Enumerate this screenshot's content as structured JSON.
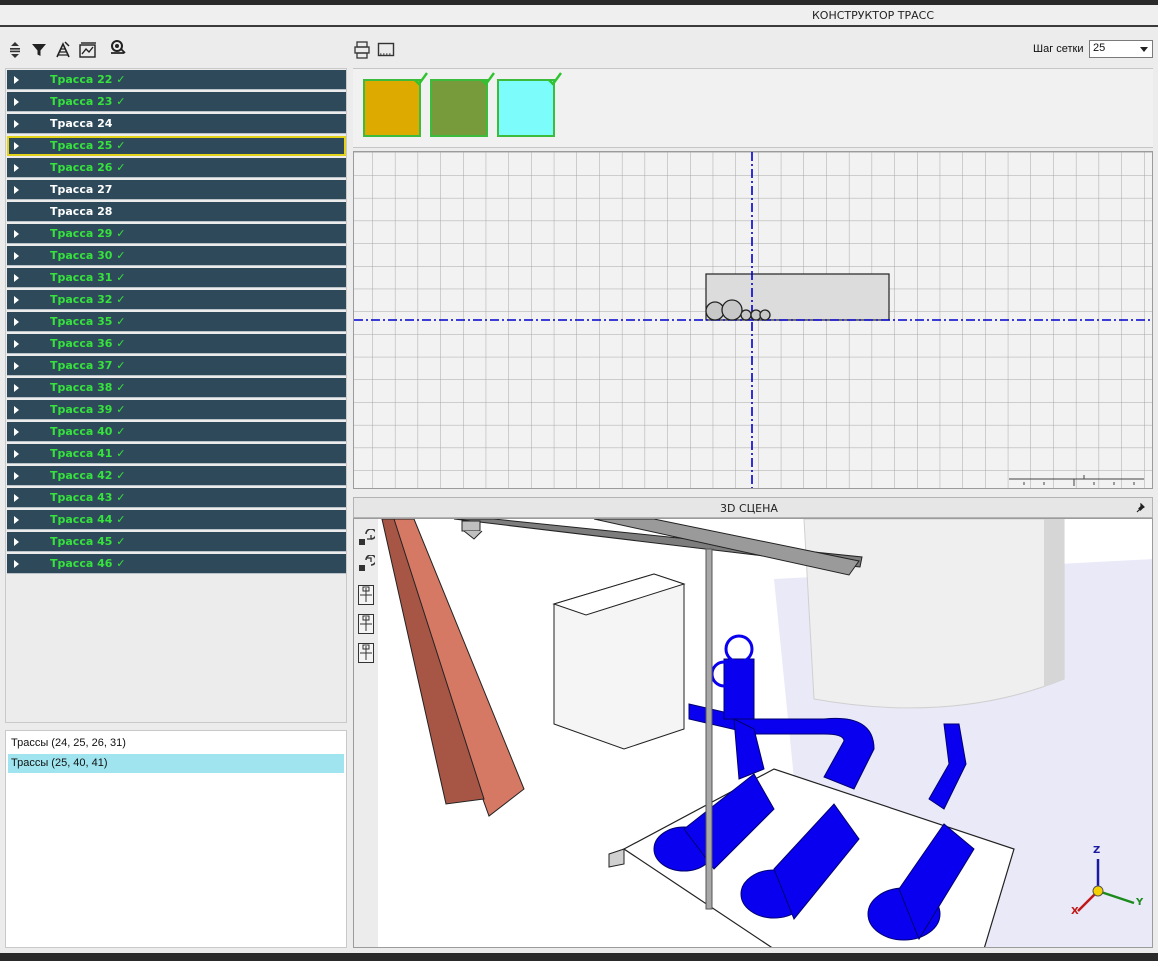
{
  "window": {
    "title": "КОНСТРУКТОР ТРАСС"
  },
  "left_toolbar": {
    "icons": [
      "collapse-expand-icon",
      "filter-icon",
      "add-trace-icon",
      "trace-settings-icon",
      "pipe-support-icon"
    ]
  },
  "center_toolbar": {
    "icons": [
      "print-layout-icon",
      "frame-icon"
    ]
  },
  "grid": {
    "label": "Шаг сетки",
    "value": "25"
  },
  "traces": [
    {
      "label": "Трасса 22 ✓",
      "status": "ok",
      "expandable": true
    },
    {
      "label": "Трасса 23 ✓",
      "status": "ok",
      "expandable": true
    },
    {
      "label": "Трасса 24",
      "status": "normal",
      "expandable": true
    },
    {
      "label": "Трасса 25 ✓",
      "status": "ok",
      "expandable": true,
      "selected": true
    },
    {
      "label": "Трасса 26 ✓",
      "status": "ok",
      "expandable": true
    },
    {
      "label": "Трасса 27",
      "status": "normal",
      "expandable": true
    },
    {
      "label": "Трасса 28",
      "status": "normal",
      "expandable": false
    },
    {
      "label": "Трасса 29 ✓",
      "status": "ok",
      "expandable": true
    },
    {
      "label": "Трасса 30 ✓",
      "status": "ok",
      "expandable": true
    },
    {
      "label": "Трасса 31 ✓",
      "status": "ok",
      "expandable": true
    },
    {
      "label": "Трасса 32 ✓",
      "status": "ok",
      "expandable": true
    },
    {
      "label": "Трасса 35 ✓",
      "status": "ok",
      "expandable": true
    },
    {
      "label": "Трасса 36 ✓",
      "status": "ok",
      "expandable": true
    },
    {
      "label": "Трасса 37 ✓",
      "status": "ok",
      "expandable": true
    },
    {
      "label": "Трасса 38 ✓",
      "status": "ok",
      "expandable": true
    },
    {
      "label": "Трасса 39 ✓",
      "status": "ok",
      "expandable": true
    },
    {
      "label": "Трасса 40 ✓",
      "status": "ok",
      "expandable": true
    },
    {
      "label": "Трасса 41 ✓",
      "status": "ok",
      "expandable": true
    },
    {
      "label": "Трасса 42 ✓",
      "status": "ok",
      "expandable": true
    },
    {
      "label": "Трасса 43 ✓",
      "status": "ok",
      "expandable": true
    },
    {
      "label": "Трасса 44 ✓",
      "status": "ok",
      "expandable": true
    },
    {
      "label": "Трасса 45 ✓",
      "status": "ok",
      "expandable": true
    },
    {
      "label": "Трасса 46 ✓",
      "status": "ok",
      "expandable": true
    }
  ],
  "groups": [
    {
      "label": "Трассы (24, 25, 26, 31)",
      "selected": false
    },
    {
      "label": "Трассы (25, 40, 41)",
      "selected": true
    }
  ],
  "swatches": [
    {
      "color": "#ddaa00",
      "checked": true
    },
    {
      "color": "#779a3b",
      "checked": true
    },
    {
      "color": "#7dfcfc",
      "checked": true
    }
  ],
  "scene": {
    "title": "3D СЦЕНА",
    "tools": [
      "rotate-view-icon",
      "rotate-view-alt-icon",
      "view-front-icon",
      "view-side-icon",
      "view-top-icon"
    ],
    "axes": {
      "z": "Z",
      "y": "Y",
      "x": "X"
    }
  },
  "colors": {
    "row_bg": "#2e4a5a",
    "row_ok_text": "#36e23c",
    "selection": "#e3d21a",
    "group_selected": "#9fe4ee",
    "pipe_blue": "#0a00f0",
    "axis_line": "#0000cc"
  }
}
